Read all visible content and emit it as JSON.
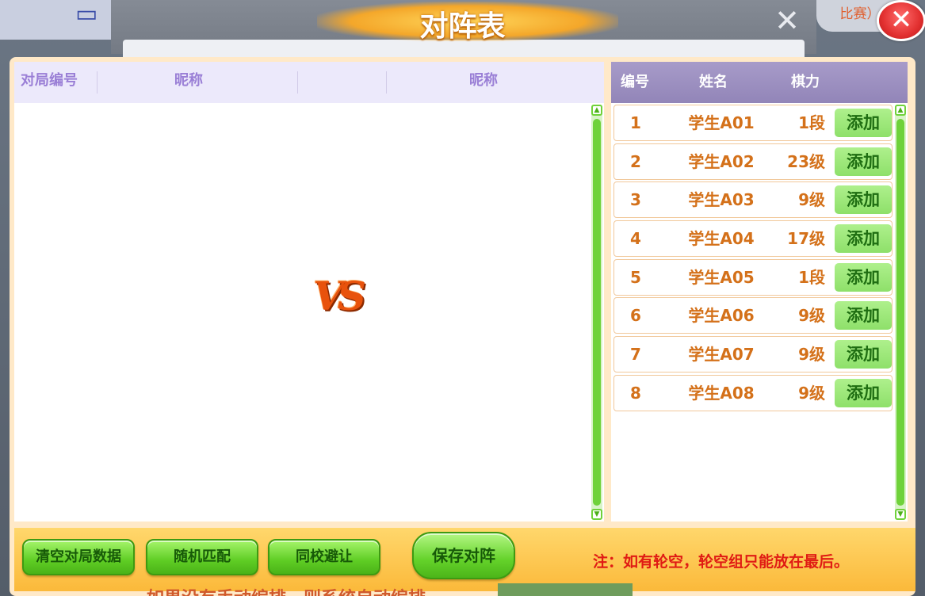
{
  "background": {
    "pill_text": "比赛）",
    "bottom_text": "如果没有手动编排，则系统自动编排"
  },
  "dialog": {
    "title": "对阵表",
    "close_icon": "close-icon",
    "ghost_close_icon": "x-icon"
  },
  "matches_table": {
    "headers": {
      "match_id": "对局编号",
      "nickname_left": "昵称",
      "nickname_right": "昵称"
    },
    "vs_label": "VS"
  },
  "players_table": {
    "headers": {
      "number": "编号",
      "name": "姓名",
      "strength": "棋力"
    },
    "add_label": "添加",
    "rows": [
      {
        "number": "1",
        "name": "学生A01",
        "rank": "1段"
      },
      {
        "number": "2",
        "name": "学生A02",
        "rank": "23级"
      },
      {
        "number": "3",
        "name": "学生A03",
        "rank": "9级"
      },
      {
        "number": "4",
        "name": "学生A04",
        "rank": "17级"
      },
      {
        "number": "5",
        "name": "学生A05",
        "rank": "1段"
      },
      {
        "number": "6",
        "name": "学生A06",
        "rank": "9级"
      },
      {
        "number": "7",
        "name": "学生A07",
        "rank": "9级"
      },
      {
        "number": "8",
        "name": "学生A08",
        "rank": "9级"
      }
    ]
  },
  "footer": {
    "clear_label": "清空对局数据",
    "random_label": "随机匹配",
    "same_school_label": "同校避让",
    "save_label": "保存对阵",
    "note": "注：如有轮空，轮空组只能放在最后。"
  },
  "colors": {
    "accent_orange": "#d4711a",
    "header_purple": "#9a7fd6",
    "button_green": "#5fcd24",
    "note_red": "#e01b14"
  }
}
